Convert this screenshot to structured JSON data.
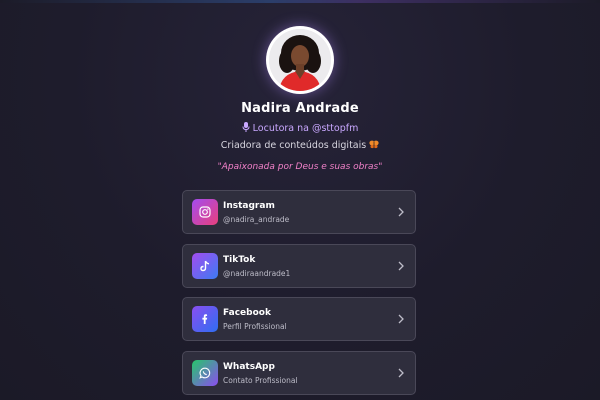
{
  "profile": {
    "name": "Nadira Andrade",
    "role": "Locutora na @sttopfm",
    "description": "Criadora de conteúdos digitais",
    "quote": "\"Apaixonada por Deus e suas obras\""
  },
  "links": [
    {
      "title": "Instagram",
      "subtitle": "@nadira_andrade",
      "icon": "instagram-icon"
    },
    {
      "title": "TikTok",
      "subtitle": "@nadiraandrade1",
      "icon": "tiktok-icon"
    },
    {
      "title": "Facebook",
      "subtitle": "Perfil Profissional",
      "icon": "facebook-icon"
    },
    {
      "title": "WhatsApp",
      "subtitle": "Contato Profissional",
      "icon": "whatsapp-icon"
    }
  ],
  "colors": {
    "background": "#1e1c2c",
    "card": "#2f2e3d",
    "role_text": "#c9a8ff",
    "quote_text": "#f080c8"
  }
}
